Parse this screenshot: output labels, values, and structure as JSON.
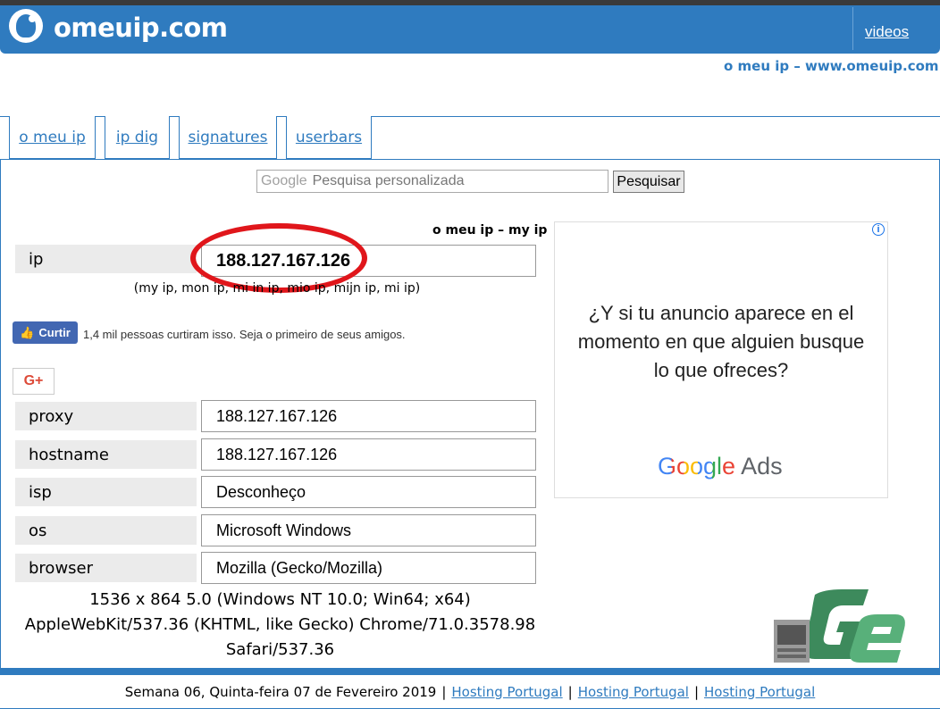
{
  "header": {
    "logo_text": "omeuip.com",
    "videos_label": "videos",
    "tagline": "o meu ip – www.omeuip.com"
  },
  "tabs": [
    "o meu ip",
    "ip dig",
    "signatures",
    "userbars"
  ],
  "search": {
    "placeholder": "Pesquisa personalizada",
    "google_mark": "Google",
    "button_label": "Pesquisar"
  },
  "main": {
    "heading": "o meu ip – my ip",
    "ip_label": "ip",
    "ip_value": "188.127.167.126",
    "ip_aliases": "(my ip, mon ip, mi in ip, mio ip, mijn ip, mi ip)",
    "like_label": "Curtir",
    "like_text": "1,4 mil pessoas curtiram isso. Seja o primeiro de seus amigos.",
    "gplus_label": "G+",
    "rows": [
      {
        "label": "proxy",
        "value": "188.127.167.126"
      },
      {
        "label": "hostname",
        "value": "188.127.167.126"
      },
      {
        "label": "isp",
        "value": "Desconheço"
      },
      {
        "label": "os",
        "value": "Microsoft Windows"
      },
      {
        "label": "browser",
        "value": "Mozilla (Gecko/Mozilla)"
      }
    ],
    "ua_lines": [
      "1536 x 864 5.0 (Windows NT 10.0; Win64; x64)",
      "AppleWebKit/537.36 (KHTML, like Gecko) Chrome/71.0.3578.98",
      "Safari/537.36"
    ]
  },
  "ad": {
    "info_icon": "i",
    "text": "¿Y si tu anuncio aparece en el momento en que alguien busque lo que ofreces?",
    "logo_google": "Google",
    "logo_ads": "Ads"
  },
  "footer": {
    "date_text": "Semana 06, Quinta-feira 07 de Fevereiro 2019",
    "links": [
      "Hosting Portugal",
      "Hosting Portugal",
      "Hosting Portugal"
    ]
  },
  "colors": {
    "brand_blue": "#2f7bbf",
    "highlight_red": "#e0161b",
    "facebook_blue": "#4267b2"
  }
}
